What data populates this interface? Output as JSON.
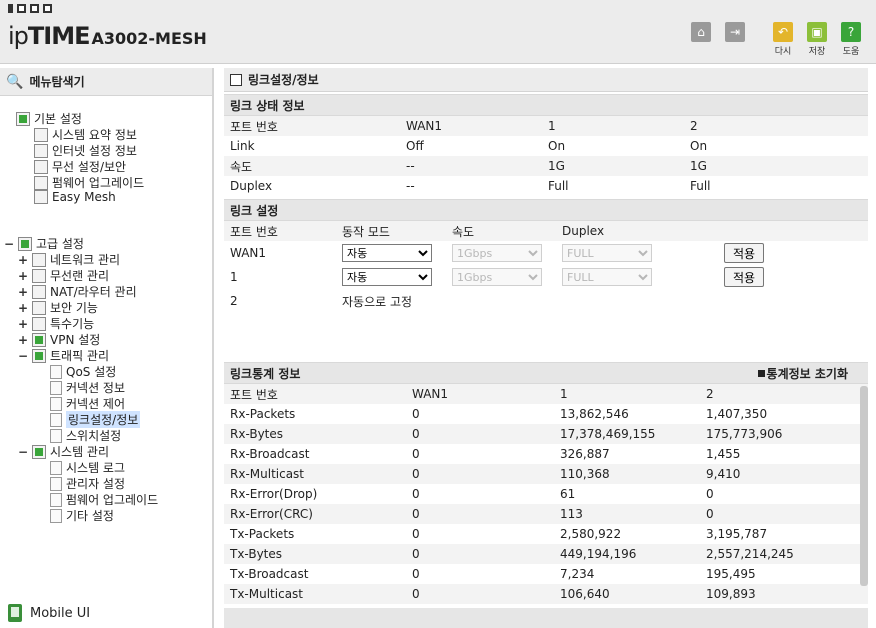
{
  "header": {
    "logo_ip": "ip",
    "logo_time": "TIME",
    "model": "A3002-MESH",
    "buttons": {
      "back": "다시",
      "save": "저장",
      "help": "도움"
    }
  },
  "sidebar": {
    "title": "메뉴탐색기",
    "basic": {
      "label": "기본 설정",
      "items": [
        "시스템 요약 정보",
        "인터넷 설정 정보",
        "무선 설정/보안",
        "펌웨어 업그레이드",
        "Easy Mesh"
      ]
    },
    "advanced": {
      "label": "고급 설정",
      "items": [
        "네트워크 관리",
        "무선랜 관리",
        "NAT/라우터 관리",
        "보안 기능",
        "특수기능",
        "VPN 설정",
        "트래픽 관리"
      ],
      "traffic_items": [
        "QoS 설정",
        "커넥션 정보",
        "커넥션 제어",
        "링크설정/정보",
        "스위치설정"
      ],
      "system": "시스템 관리",
      "system_items": [
        "시스템 로그",
        "관리자 설정",
        "펌웨어 업그레이드",
        "기타 설정"
      ]
    },
    "mobile": "Mobile UI"
  },
  "main": {
    "title": "링크설정/정보",
    "status": {
      "title": "링크 상태 정보",
      "headers": [
        "포트 번호",
        "WAN1",
        "1",
        "2"
      ],
      "rows": [
        [
          "Link",
          "Off",
          "On",
          "On"
        ],
        [
          "속도",
          "--",
          "1G",
          "1G"
        ],
        [
          "Duplex",
          "--",
          "Full",
          "Full"
        ]
      ]
    },
    "settings": {
      "title": "링크 설정",
      "headers": [
        "포트 번호",
        "동작 모드",
        "속도",
        "Duplex"
      ],
      "rows": [
        {
          "port": "WAN1",
          "mode": "자동",
          "speed": "1Gbps",
          "duplex": "FULL",
          "apply": "적용"
        },
        {
          "port": "1",
          "mode": "자동",
          "speed": "1Gbps",
          "duplex": "FULL",
          "apply": "적용"
        }
      ],
      "fixed_port": "2",
      "fixed_text": "자동으로 고정"
    },
    "stats": {
      "title": "링크통계 정보",
      "reset": "통계정보 초기화",
      "headers": [
        "포트 번호",
        "WAN1",
        "1",
        "2"
      ],
      "rows": [
        [
          "Rx-Packets",
          "0",
          "13,862,546",
          "1,407,350"
        ],
        [
          "Rx-Bytes",
          "0",
          "17,378,469,155",
          "175,773,906"
        ],
        [
          "Rx-Broadcast",
          "0",
          "326,887",
          "1,455"
        ],
        [
          "Rx-Multicast",
          "0",
          "110,368",
          "9,410"
        ],
        [
          "Rx-Error(Drop)",
          "0",
          "61",
          "0"
        ],
        [
          "Rx-Error(CRC)",
          "0",
          "113",
          "0"
        ],
        [
          "Tx-Packets",
          "0",
          "2,580,922",
          "3,195,787"
        ],
        [
          "Tx-Bytes",
          "0",
          "449,194,196",
          "2,557,214,245"
        ],
        [
          "Tx-Broadcast",
          "0",
          "7,234",
          "195,495"
        ],
        [
          "Tx-Multicast",
          "0",
          "106,640",
          "109,893"
        ]
      ]
    }
  }
}
